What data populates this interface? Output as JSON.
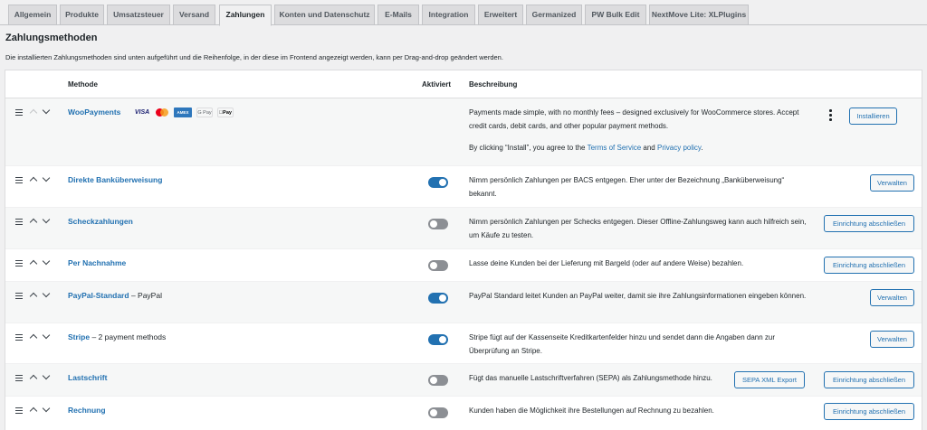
{
  "tabs": [
    "Allgemein",
    "Produkte",
    "Umsatzsteuer",
    "Versand",
    "Zahlungen",
    "Konten und Datenschutz",
    "E-Mails",
    "Integration",
    "Erweitert",
    "Germanized",
    "PW Bulk Edit",
    "NextMove Lite: XLPlugins"
  ],
  "active_tab": "Zahlungen",
  "page": {
    "title": "Zahlungsmethoden",
    "description": "Die installierten Zahlungsmethoden sind unten aufgeführt und die Reihenfolge, in der diese im Frontend angezeigt werden, kann per Drag-and-drop geändert werden."
  },
  "table": {
    "headers": {
      "method": "Methode",
      "active": "Aktiviert",
      "description": "Beschreibung"
    },
    "rows": [
      {
        "name": "WooPayments",
        "extra": "",
        "cards": [
          "VISA",
          "MC",
          "AMEX",
          "G Pay",
          "Pay"
        ],
        "active": null,
        "description": "Payments made simple, with no monthly fees – designed exclusively for WooCommerce stores. Accept credit cards, debit cards, and other popular payment methods.",
        "consent_prefix": "By clicking “Install”, you agree to the",
        "consent_link1": "Terms of Service",
        "consent_and": "and",
        "consent_link2": "Privacy policy",
        "consent_suffix": ".",
        "action": "Installieren",
        "secondary_action": ""
      },
      {
        "name": "Direkte Banküberweisung",
        "extra": "",
        "active": true,
        "description": "Nimm persönlich Zahlungen per BACS entgegen. Eher unter der Bezeichnung „Banküberweisung“ bekannt.",
        "action": "Verwalten",
        "secondary_action": ""
      },
      {
        "name": "Scheckzahlungen",
        "extra": "",
        "active": false,
        "description": "Nimm persönlich Zahlungen per Schecks entgegen. Dieser Offline-Zahlungsweg kann auch hilfreich sein, um Käufe zu testen.",
        "action": "Einrichtung abschließen",
        "secondary_action": ""
      },
      {
        "name": "Per Nachnahme",
        "extra": "",
        "active": false,
        "description": "Lasse deine Kunden bei der Lieferung mit Bargeld (oder auf andere Weise) bezahlen.",
        "action": "Einrichtung abschließen",
        "secondary_action": ""
      },
      {
        "name": "PayPal-Standard",
        "extra": "– PayPal",
        "active": true,
        "description": "PayPal Standard leitet Kunden an PayPal weiter, damit sie ihre Zahlungsinformationen eingeben können.",
        "action": "Verwalten",
        "secondary_action": ""
      },
      {
        "name": "Stripe",
        "extra": "– 2 payment methods",
        "active": true,
        "description": "Stripe fügt auf der Kassenseite Kreditkartenfelder hinzu und sendet dann die Angaben dann zur Überprüfung an Stripe.",
        "action": "Verwalten",
        "secondary_action": ""
      },
      {
        "name": "Lastschrift",
        "extra": "",
        "active": false,
        "description": "Fügt das manuelle Lastschriftverfahren (SEPA) als Zahlungsmethode hinzu.",
        "action": "Einrichtung abschließen",
        "secondary_action": "SEPA XML Export"
      },
      {
        "name": "Rechnung",
        "extra": "",
        "active": false,
        "description": "Kunden haben die Möglichkeit ihre Bestellungen auf Rechnung zu bezahlen.",
        "action": "Einrichtung abschließen",
        "secondary_action": ""
      }
    ]
  }
}
